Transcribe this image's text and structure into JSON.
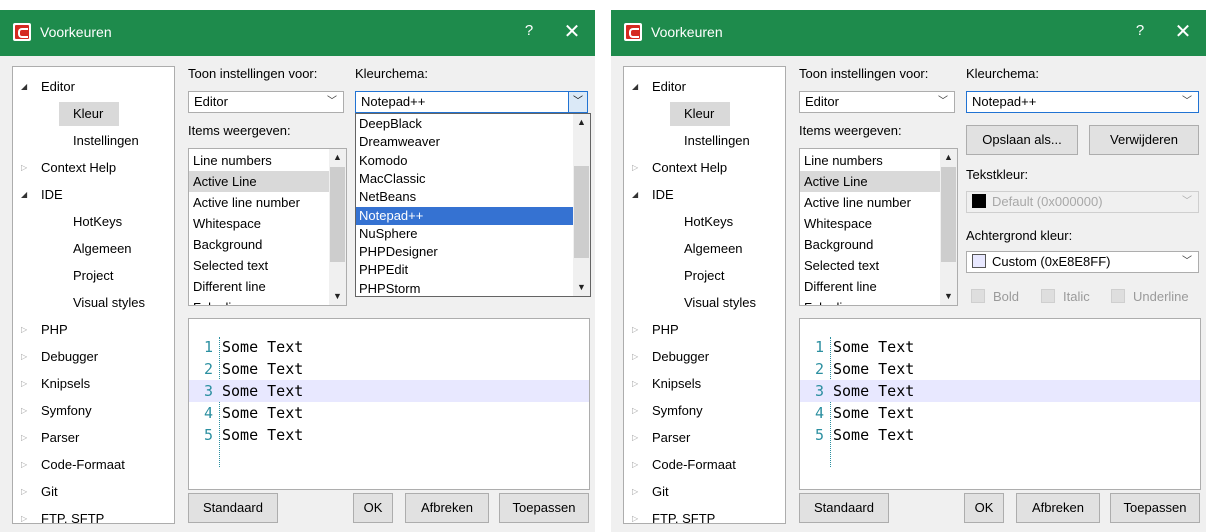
{
  "dialog": {
    "title": "Voorkeuren",
    "help": "?",
    "close": "✕"
  },
  "tree": [
    {
      "label": "Editor",
      "arrow": "◢",
      "indent": 0
    },
    {
      "label": "Kleur",
      "arrow": "",
      "indent": 1,
      "selected": true
    },
    {
      "label": "Instellingen",
      "arrow": "",
      "indent": 1
    },
    {
      "label": "Context Help",
      "arrow": "▷",
      "indent": 0
    },
    {
      "label": "IDE",
      "arrow": "◢",
      "indent": 0
    },
    {
      "label": "HotKeys",
      "arrow": "",
      "indent": 1
    },
    {
      "label": "Algemeen",
      "arrow": "",
      "indent": 1
    },
    {
      "label": "Project",
      "arrow": "",
      "indent": 1
    },
    {
      "label": "Visual styles",
      "arrow": "",
      "indent": 1
    },
    {
      "label": "PHP",
      "arrow": "▷",
      "indent": 0
    },
    {
      "label": "Debugger",
      "arrow": "▷",
      "indent": 0
    },
    {
      "label": "Knipsels",
      "arrow": "▷",
      "indent": 0
    },
    {
      "label": "Symfony",
      "arrow": "▷",
      "indent": 0
    },
    {
      "label": "Parser",
      "arrow": "▷",
      "indent": 0
    },
    {
      "label": "Code-Formaat",
      "arrow": "▷",
      "indent": 0
    },
    {
      "label": "Git",
      "arrow": "▷",
      "indent": 0
    },
    {
      "label": "FTP, SFTP",
      "arrow": "▷",
      "indent": 0
    }
  ],
  "settings": {
    "show_for_label": "Toon instellingen voor:",
    "show_for_value": "Editor",
    "scheme_label": "Kleurchema:",
    "scheme_value": "Notepad++",
    "items_label": "Items weergeven:"
  },
  "items": [
    {
      "label": "Line numbers"
    },
    {
      "label": "Active Line",
      "selected": true
    },
    {
      "label": "Active line number"
    },
    {
      "label": "Whitespace"
    },
    {
      "label": "Background"
    },
    {
      "label": "Selected text"
    },
    {
      "label": "Different line"
    },
    {
      "label": "Fake line"
    }
  ],
  "scheme_options": [
    {
      "label": "DeepBlack"
    },
    {
      "label": "Dreamweaver"
    },
    {
      "label": "Komodo"
    },
    {
      "label": "MacClassic"
    },
    {
      "label": "NetBeans"
    },
    {
      "label": "Notepad++",
      "selected": true
    },
    {
      "label": "NuSphere"
    },
    {
      "label": "PHPDesigner"
    },
    {
      "label": "PHPEdit"
    },
    {
      "label": "PHPStorm"
    }
  ],
  "style_panel": {
    "save_as": "Opslaan als...",
    "delete": "Verwijderen",
    "text_color_label": "Tekstkleur:",
    "text_color_value": "Default (0x000000)",
    "text_color_swatch": "#000000",
    "bg_color_label": "Achtergrond kleur:",
    "bg_color_value": "Custom (0xE8E8FF)",
    "bg_color_swatch": "#E8E8FF",
    "bold": "Bold",
    "italic": "Italic",
    "underline": "Underline"
  },
  "preview": [
    {
      "num": "1",
      "text": "Some Text"
    },
    {
      "num": "2",
      "text": "Some Text"
    },
    {
      "num": "3",
      "text": "Some Text",
      "highlight": true
    },
    {
      "num": "4",
      "text": "Some Text"
    },
    {
      "num": "5",
      "text": "Some Text"
    }
  ],
  "buttons": {
    "default": "Standaard",
    "ok": "OK",
    "cancel": "Afbreken",
    "apply": "Toepassen"
  },
  "colors": {
    "titlebar": "#1E8B4C",
    "highlight_line": "#E8E8FF",
    "dropdown_selection": "#3572D2",
    "line_number": "#2B8FA0"
  }
}
